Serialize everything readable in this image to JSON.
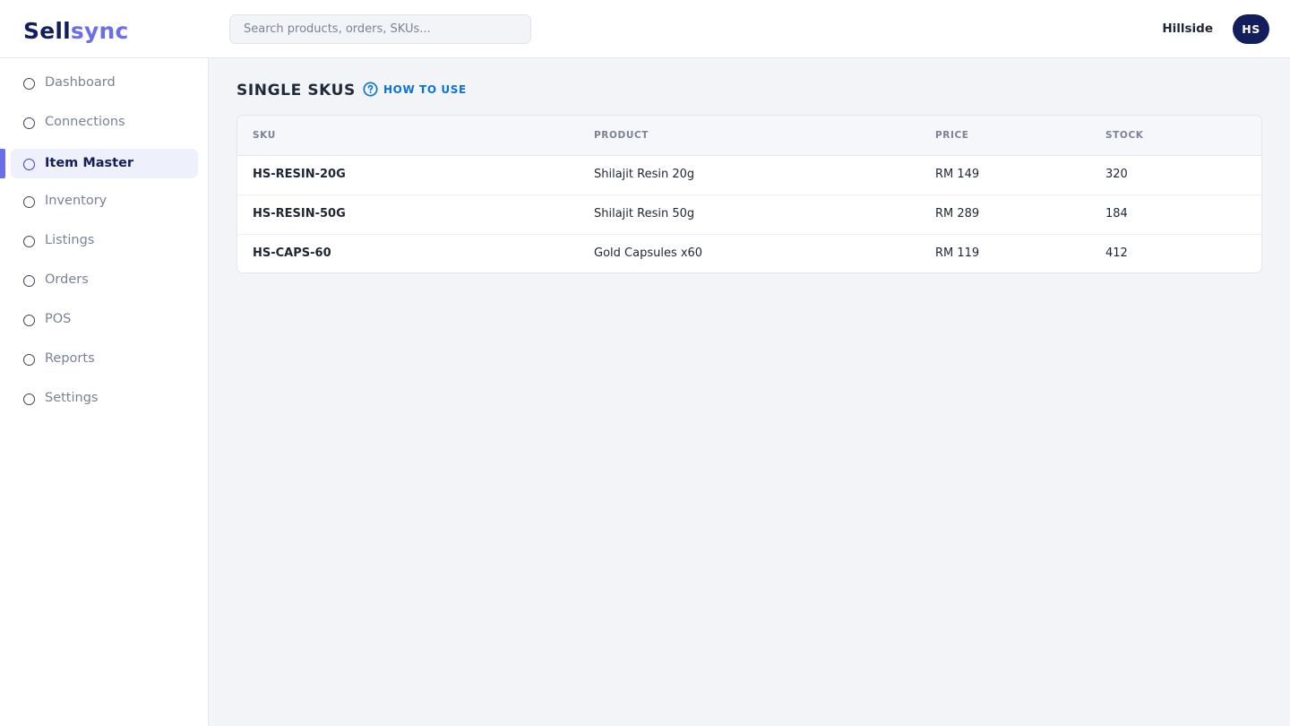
{
  "brand": {
    "part1": "Sell",
    "part2": "sync"
  },
  "search": {
    "placeholder": "Search products, orders, SKUs..."
  },
  "account": {
    "name": "Hillside",
    "initials": "HS"
  },
  "sidebar": {
    "items": [
      {
        "label": "Dashboard"
      },
      {
        "label": "Connections"
      },
      {
        "label": "Item Master",
        "active": true
      },
      {
        "label": "Inventory"
      },
      {
        "label": "Listings"
      },
      {
        "label": "Orders"
      },
      {
        "label": "POS"
      },
      {
        "label": "Reports"
      },
      {
        "label": "Settings"
      }
    ]
  },
  "page": {
    "title": "SINGLE SKUS",
    "help_label": "HOW TO USE"
  },
  "table": {
    "headers": [
      "SKU",
      "PRODUCT",
      "PRICE",
      "STOCK"
    ],
    "rows": [
      [
        "HS-RESIN-20G",
        "Shilajit Resin 20g",
        "RM 149",
        "320"
      ],
      [
        "HS-RESIN-50G",
        "Shilajit Resin 50g",
        "RM 289",
        "184"
      ],
      [
        "HS-CAPS-60",
        "Gold Capsules x60",
        "RM 119",
        "412"
      ]
    ]
  },
  "colors": {
    "brand_dark": "#131f5c",
    "brand_accent": "#6a6fe8",
    "link": "#0b72d9"
  }
}
